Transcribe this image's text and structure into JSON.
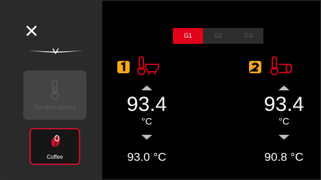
{
  "sidebar": {
    "temperatures_label": "Temperatures",
    "coffee_label": "Coffee"
  },
  "group_tabs": [
    "G1",
    "G2",
    "G3"
  ],
  "active_group": "G1",
  "boilers": [
    {
      "badge": "1",
      "icon": "group-head-thermometer-icon",
      "setpoint": "93.4",
      "unit": "°C",
      "actual": "93.0 °C"
    },
    {
      "badge": "2",
      "icon": "boiler-thermometer-icon",
      "setpoint": "93.4",
      "unit": "°C",
      "actual": "90.8 °C"
    }
  ],
  "colors": {
    "accent_red": "#e2001a",
    "badge_orange": "#f5a81c",
    "sidebar_bg": "#2a2a2a",
    "main_bg": "#000000"
  }
}
